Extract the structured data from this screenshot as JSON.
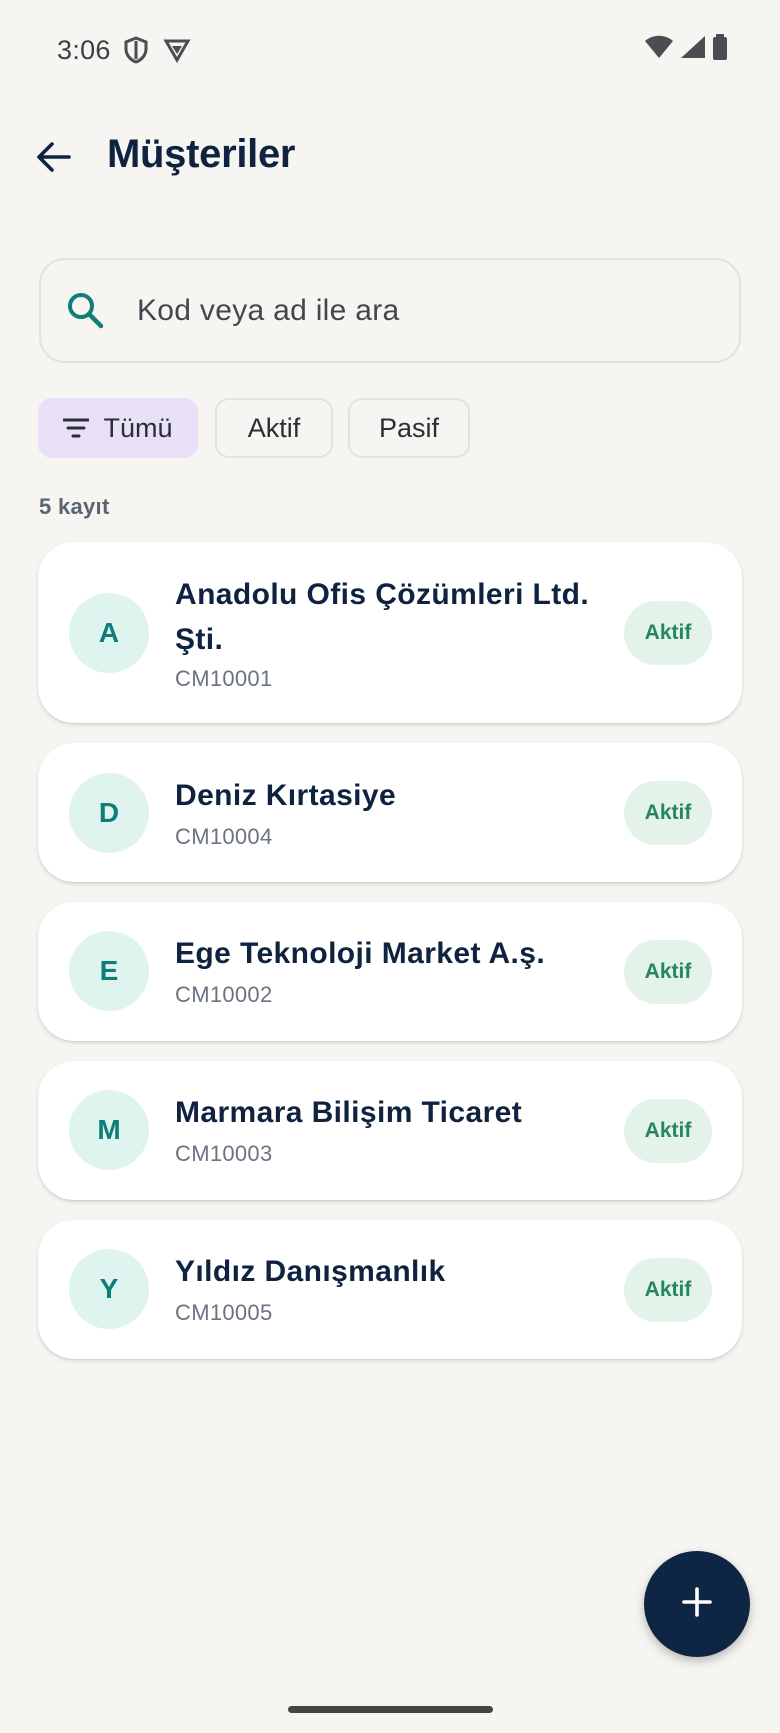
{
  "status_bar": {
    "time": "3:06",
    "icons": [
      "shield-icon",
      "vpn-icon",
      "wifi-icon",
      "signal-icon",
      "battery-icon"
    ]
  },
  "header": {
    "back_icon": "arrow-back-icon",
    "title": "Müşteriler"
  },
  "search": {
    "placeholder": "Kod veya ad ile ara",
    "value": "",
    "icon": "search-icon"
  },
  "filters": {
    "items": [
      {
        "label": "Tümü",
        "selected": true,
        "icon": "filter-icon"
      },
      {
        "label": "Aktif",
        "selected": false
      },
      {
        "label": "Pasif",
        "selected": false
      }
    ]
  },
  "list": {
    "count_label": "5 kayıt",
    "customers": [
      {
        "initial": "A",
        "name": "Anadolu Ofis Çözümleri Ltd. Şti.",
        "code": "CM10001",
        "status": "Aktif"
      },
      {
        "initial": "D",
        "name": "Deniz Kırtasiye",
        "code": "CM10004",
        "status": "Aktif"
      },
      {
        "initial": "E",
        "name": "Ege Teknoloji Market A.ş.",
        "code": "CM10002",
        "status": "Aktif"
      },
      {
        "initial": "M",
        "name": "Marmara Bilişim Ticaret",
        "code": "CM10003",
        "status": "Aktif"
      },
      {
        "initial": "Y",
        "name": "Yıldız Danışmanlık",
        "code": "CM10005",
        "status": "Aktif"
      }
    ]
  },
  "fab": {
    "icon": "add-icon"
  },
  "colors": {
    "background": "#f6f5f1",
    "title": "#0f2340",
    "accent_teal": "#0f7d78",
    "status_green": "#25875a",
    "chip_selected": "#e8e0f6",
    "fab": "#0f2544"
  }
}
